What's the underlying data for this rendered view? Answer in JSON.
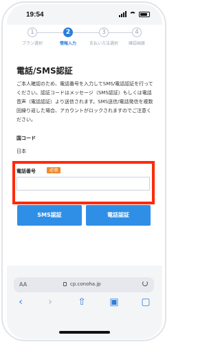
{
  "status": {
    "time": "19:54"
  },
  "steps": [
    {
      "num": "1",
      "label": "プラン選択"
    },
    {
      "num": "2",
      "label": "情報入力"
    },
    {
      "num": "3",
      "label": "支払い方法選択"
    },
    {
      "num": "4",
      "label": "確認画面"
    }
  ],
  "page": {
    "title": "電話/SMS認証",
    "description": "ご本人確認のため、電話番号を入力してSMS/電話認証を行ってください。認証コードはメッセージ（SMS認証）もしくは電話音声（電話認証）より送信されます。SMS送信/電話発信を複数回繰り返した場合、アカウントがロックされますのでご注意ください。",
    "country_label": "国コード",
    "country_value": "日本",
    "phone_label": "電話番号",
    "required_badge": "必須",
    "phone_value": "",
    "sms_button": "SMS認証",
    "voice_button": "電話認証"
  },
  "browser": {
    "aa": "AA",
    "url": "cp.conoha.jp"
  },
  "colors": {
    "accent": "#2f8fe6",
    "highlight": "#ff2a0a",
    "required": "#f28a2b"
  }
}
